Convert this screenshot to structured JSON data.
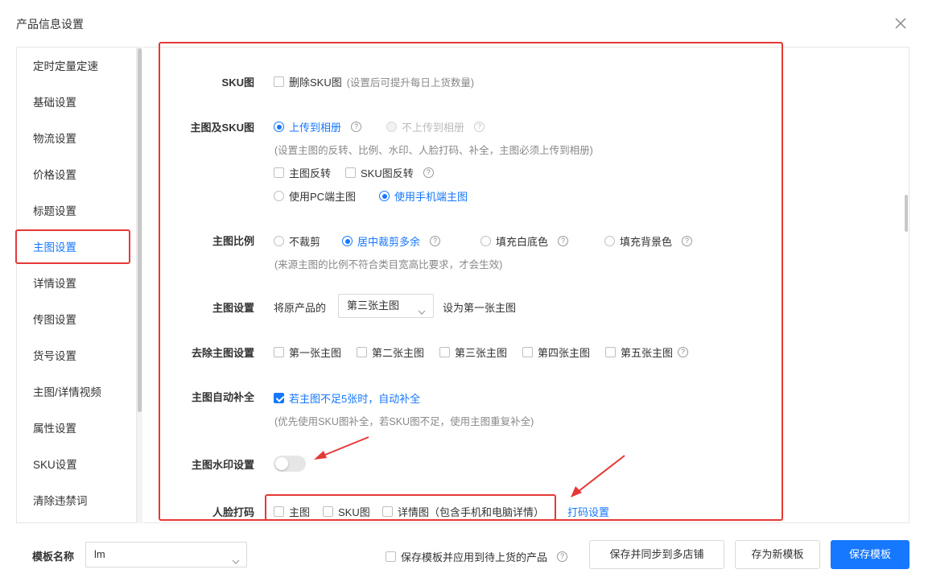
{
  "dialog": {
    "title": "产品信息设置",
    "close_icon": "close-icon"
  },
  "sidebar": {
    "items": [
      {
        "label": "定时定量定速"
      },
      {
        "label": "基础设置"
      },
      {
        "label": "物流设置"
      },
      {
        "label": "价格设置"
      },
      {
        "label": "标题设置"
      },
      {
        "label": "主图设置",
        "active": true
      },
      {
        "label": "详情设置"
      },
      {
        "label": "传图设置"
      },
      {
        "label": "货号设置"
      },
      {
        "label": "主图/详情视频"
      },
      {
        "label": "属性设置"
      },
      {
        "label": "SKU设置"
      },
      {
        "label": "清除违禁词"
      }
    ]
  },
  "settings": {
    "sku_img": {
      "label": "SKU图",
      "option": "删除SKU图",
      "hint": "(设置后可提升每日上货数量)"
    },
    "main_sku": {
      "label": "主图及SKU图",
      "upload": "上传到相册",
      "no_upload": "不上传到相册",
      "hint": "(设置主图的反转、比例、水印、人脸打码、补全，主图必须上传到相册)",
      "flip_main": "主图反转",
      "flip_sku": "SKU图反转",
      "use_pc": "使用PC端主图",
      "use_mobile": "使用手机端主图"
    },
    "ratio": {
      "label": "主图比例",
      "no_crop": "不裁剪",
      "center_crop": "居中裁剪多余",
      "fill_white": "填充白底色",
      "fill_bg": "填充背景色",
      "hint": "(来源主图的比例不符合类目宽高比要求，才会生效)"
    },
    "main_set": {
      "label": "主图设置",
      "prefix": "将原产品的",
      "selected": "第三张主图",
      "suffix": "设为第一张主图"
    },
    "remove": {
      "label": "去除主图设置",
      "opts": [
        "第一张主图",
        "第二张主图",
        "第三张主图",
        "第四张主图",
        "第五张主图"
      ]
    },
    "autofill": {
      "label": "主图自动补全",
      "option": "若主图不足5张时，自动补全",
      "hint": "(优先使用SKU图补全，若SKU图不足，使用主图重复补全)"
    },
    "watermark": {
      "label": "主图水印设置",
      "enabled": false
    },
    "face": {
      "label": "人脸打码",
      "main": "主图",
      "sku": "SKU图",
      "detail": "详情图（包含手机和电脑详情）",
      "link": "打码设置"
    }
  },
  "footer": {
    "name_label": "模板名称",
    "name_value": "lm",
    "apply_option": "保存模板并应用到待上货的产品",
    "sync_btn": "保存并同步到多店铺",
    "save_new_btn": "存为新模板",
    "save_btn": "保存模板"
  },
  "colors": {
    "accent": "#1677ff",
    "annotation": "#e53935"
  }
}
